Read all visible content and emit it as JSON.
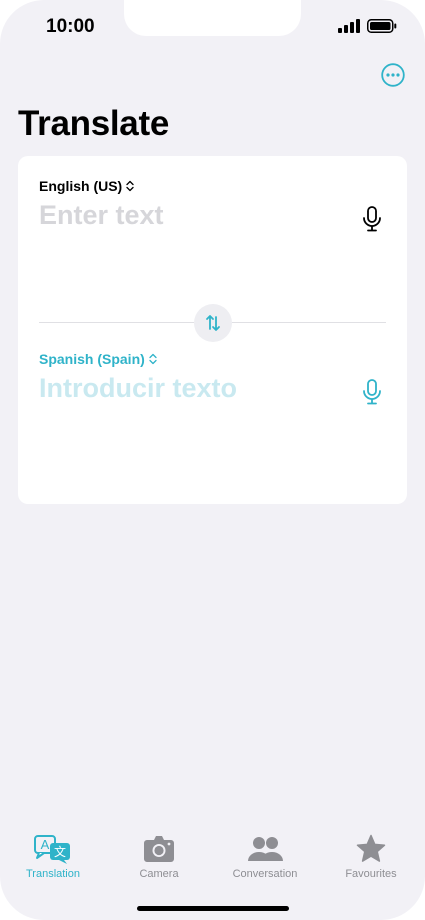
{
  "status_bar": {
    "time": "10:00"
  },
  "header": {
    "title": "Translate"
  },
  "translator": {
    "source_language": "English (US)",
    "source_placeholder": "Enter text",
    "target_language": "Spanish (Spain)",
    "target_placeholder": "Introducir texto"
  },
  "tabs": [
    {
      "label": "Translation",
      "icon": "translation-icon",
      "active": true
    },
    {
      "label": "Camera",
      "icon": "camera-icon",
      "active": false
    },
    {
      "label": "Conversation",
      "icon": "conversation-icon",
      "active": false
    },
    {
      "label": "Favourites",
      "icon": "star-icon",
      "active": false
    }
  ],
  "colors": {
    "accent": "#2fb3c9",
    "background": "#f2f1f6",
    "card": "#ffffff",
    "placeholder": "#d6d6da",
    "target_placeholder": "#c9e9f0",
    "inactive_tab": "#8e8e93"
  }
}
